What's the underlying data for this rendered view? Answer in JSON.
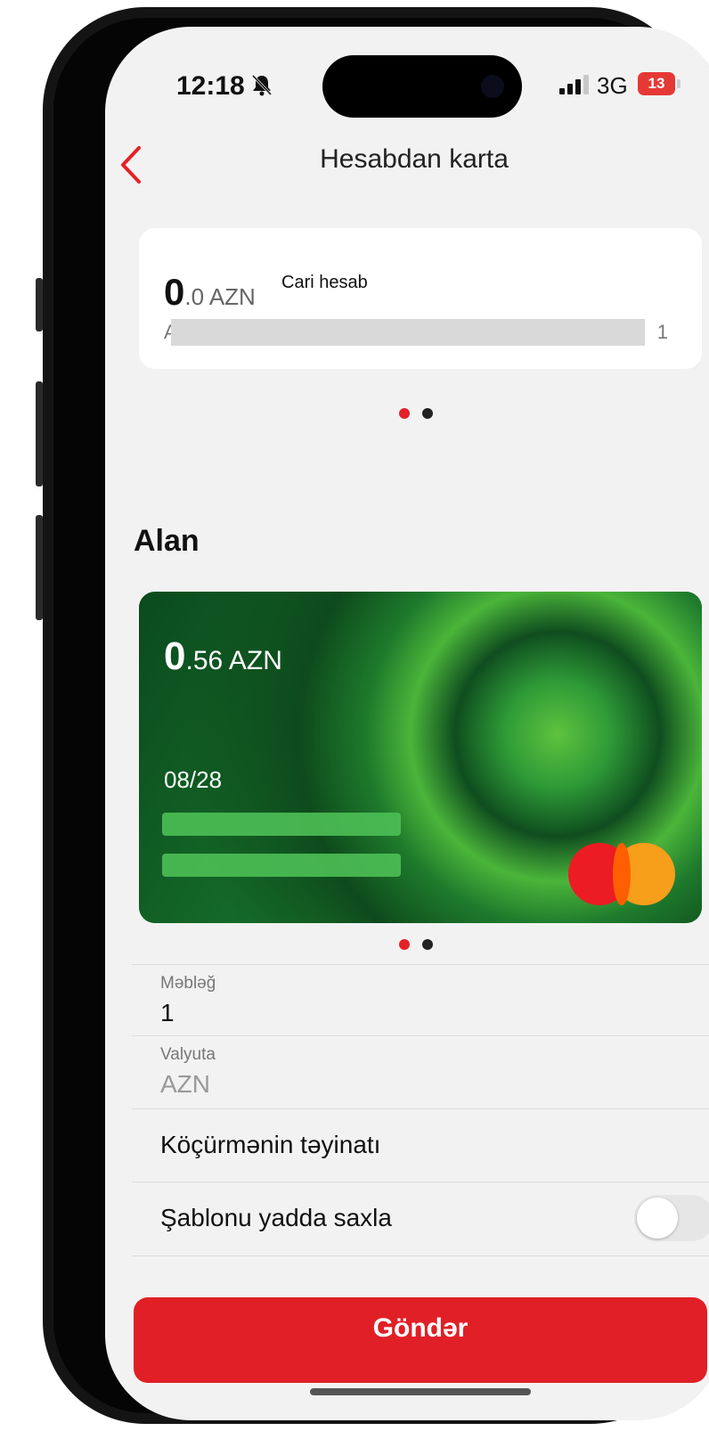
{
  "status_bar": {
    "time": "12:18",
    "network": "3G",
    "battery_level": "13",
    "battery_color": "#e53935"
  },
  "nav": {
    "title": "Hesabdan karta",
    "back_icon": "chevron-left-icon"
  },
  "source_account": {
    "amount_big": "0",
    "amount_rest": ".0 AZN",
    "type": "Cari hesab",
    "number_first_char": "A",
    "number_last_char": "1",
    "carousel_dots": 2,
    "active_dot": 0
  },
  "receiver": {
    "section_title": "Alan",
    "card": {
      "amount_big": "0",
      "amount_rest": ".56 AZN",
      "expiry": "08/28",
      "brand_icon": "mastercard-icon"
    },
    "carousel_dots": 2,
    "active_dot": 0
  },
  "form": {
    "amount_label": "Məbləğ",
    "amount_value": "1",
    "currency_label": "Valyuta",
    "currency_value": "AZN",
    "purpose_placeholder": "Köçürmənin təyinatı",
    "save_template_label": "Şablonu yadda saxla",
    "save_template_on": false
  },
  "send_button": {
    "label": "Göndər",
    "color": "#e11f26"
  },
  "colors": {
    "accent": "#e52128",
    "background": "#f2f2f2"
  }
}
